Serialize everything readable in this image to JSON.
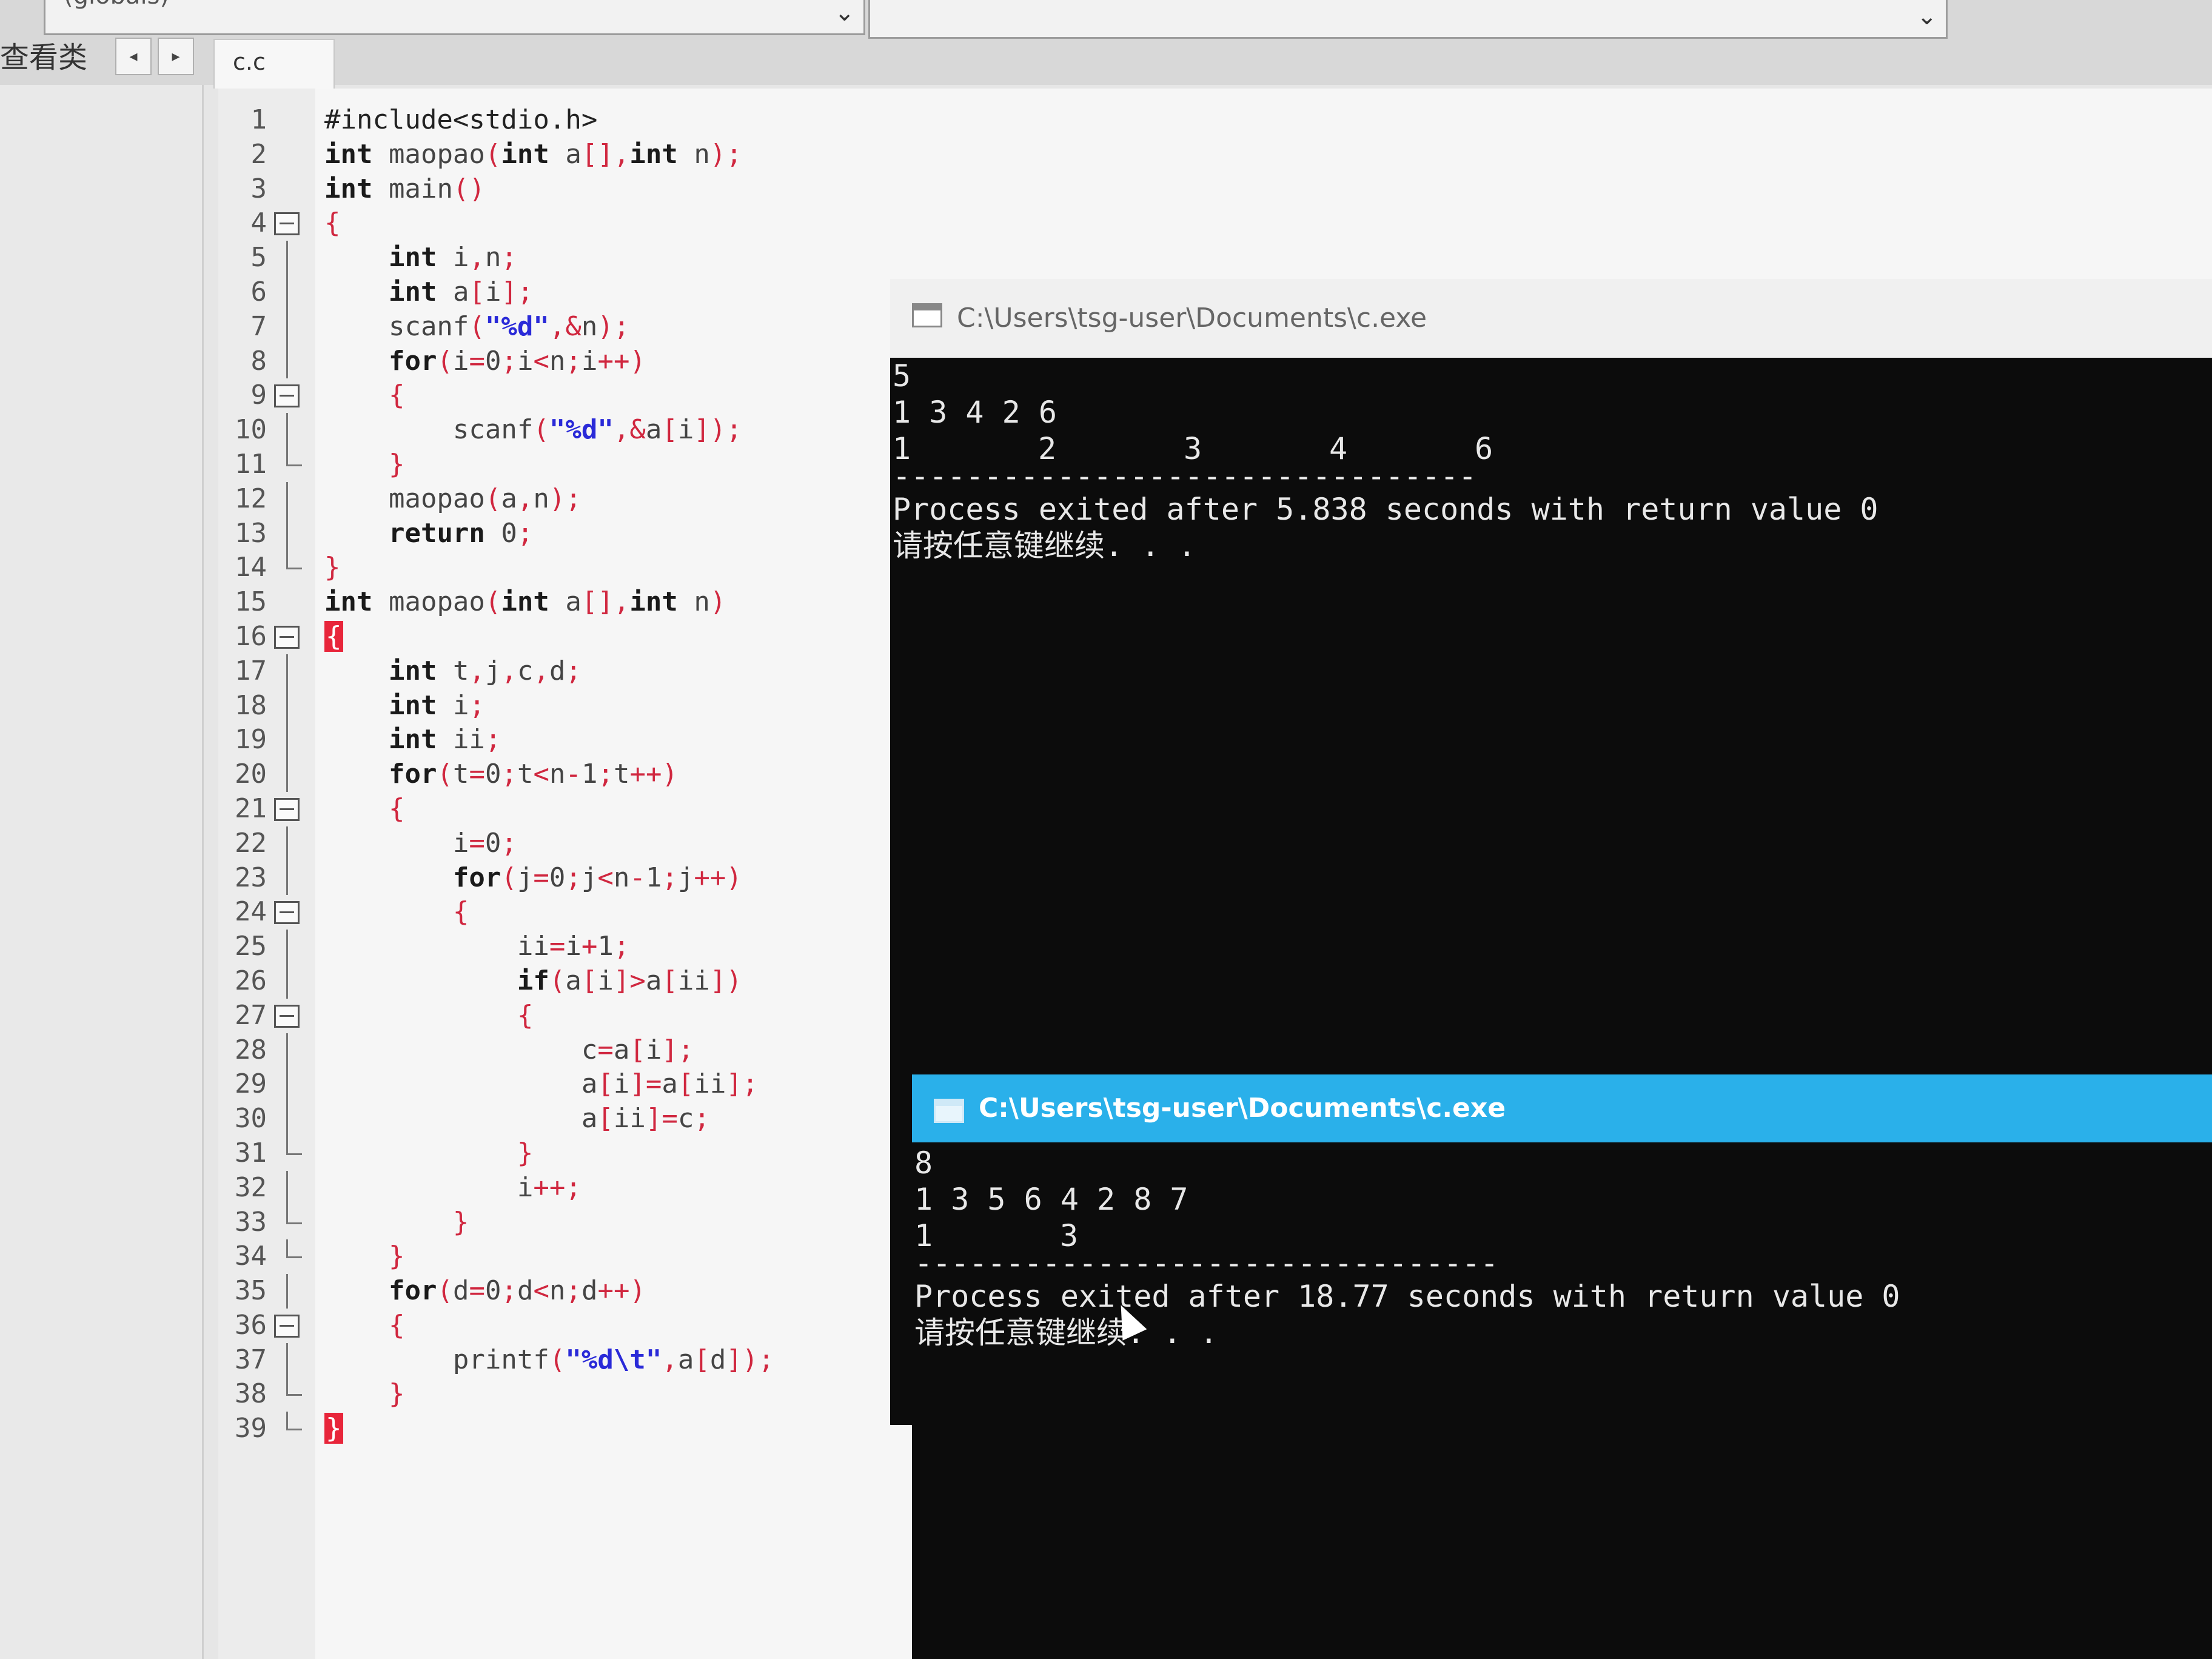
{
  "toolbar": {
    "scope_combo_text": "(globals)",
    "member_combo_text": "",
    "class_view_label": "查看类",
    "nav_prev": "◂",
    "nav_next": "▸",
    "file_tab": "c.c"
  },
  "editor": {
    "lines": [
      {
        "n": "1",
        "text": "#include<stdio.h>"
      },
      {
        "n": "2",
        "text": "int maopao(int a[],int n);"
      },
      {
        "n": "3",
        "text": "int main()"
      },
      {
        "n": "4",
        "text": "{"
      },
      {
        "n": "5",
        "text": "    int i,n;"
      },
      {
        "n": "6",
        "text": "    int a[i];"
      },
      {
        "n": "7",
        "text": "    scanf(\"%d\",&n);"
      },
      {
        "n": "8",
        "text": "    for(i=0;i<n;i++)"
      },
      {
        "n": "9",
        "text": "    {"
      },
      {
        "n": "10",
        "text": "        scanf(\"%d\",&a[i]);"
      },
      {
        "n": "11",
        "text": "    }"
      },
      {
        "n": "12",
        "text": "    maopao(a,n);"
      },
      {
        "n": "13",
        "text": "    return 0;"
      },
      {
        "n": "14",
        "text": "}"
      },
      {
        "n": "15",
        "text": "int maopao(int a[],int n)"
      },
      {
        "n": "16",
        "text": "{"
      },
      {
        "n": "17",
        "text": "    int t,j,c,d;"
      },
      {
        "n": "18",
        "text": "    int i;"
      },
      {
        "n": "19",
        "text": "    int ii;"
      },
      {
        "n": "20",
        "text": "    for(t=0;t<n-1;t++)"
      },
      {
        "n": "21",
        "text": "    {"
      },
      {
        "n": "22",
        "text": "        i=0;"
      },
      {
        "n": "23",
        "text": "        for(j=0;j<n-1;j++)"
      },
      {
        "n": "24",
        "text": "        {"
      },
      {
        "n": "25",
        "text": "            ii=i+1;"
      },
      {
        "n": "26",
        "text": "            if(a[i]>a[ii])"
      },
      {
        "n": "27",
        "text": "            {"
      },
      {
        "n": "28",
        "text": "                c=a[i];"
      },
      {
        "n": "29",
        "text": "                a[i]=a[ii];"
      },
      {
        "n": "30",
        "text": "                a[ii]=c;"
      },
      {
        "n": "31",
        "text": "            }"
      },
      {
        "n": "32",
        "text": "            i++;"
      },
      {
        "n": "33",
        "text": "        }"
      },
      {
        "n": "34",
        "text": "    }"
      },
      {
        "n": "35",
        "text": "    for(d=0;d<n;d++)"
      },
      {
        "n": "36",
        "text": "    {"
      },
      {
        "n": "37",
        "text": "        printf(\"%d\\t\",a[d]);"
      },
      {
        "n": "38",
        "text": "    }"
      },
      {
        "n": "39",
        "text": "}"
      }
    ]
  },
  "console1": {
    "title": "C:\\Users\\tsg-user\\Documents\\c.exe",
    "input_count": "5",
    "input_values": "1 3 4 2 6",
    "output_values": [
      "1",
      "2",
      "3",
      "4",
      "6"
    ],
    "separator": "--------------------------------",
    "exit_message": "Process exited after 5.838 seconds with return value 0",
    "continue_prompt": "请按任意键继续. . ."
  },
  "console2": {
    "title": "C:\\Users\\tsg-user\\Documents\\c.exe",
    "input_count": "8",
    "input_values": "1 3 5 6 4 2 8 7",
    "output_values": [
      "1",
      "3"
    ],
    "separator": "--------------------------------",
    "exit_message": "Process exited after 18.77 seconds with return value 0",
    "continue_prompt": "请按任意键继续. . ."
  },
  "colors": {
    "keyword": "#1a1a1a",
    "punctuation": "#d0273f",
    "string": "#2a2ad8",
    "active_titlebar": "#2ab0ea",
    "console_bg": "#0c0c0c"
  }
}
